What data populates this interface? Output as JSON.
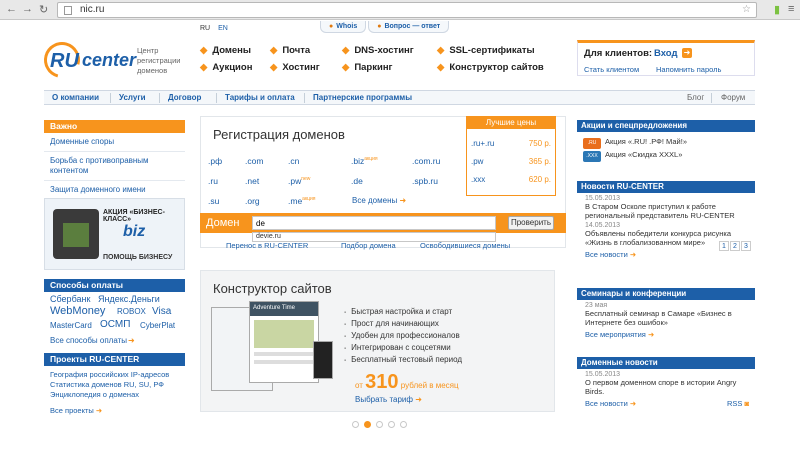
{
  "browser": {
    "url": "nic.ru"
  },
  "header": {
    "langs": [
      "RU",
      "EN"
    ],
    "top_tabs": [
      "Whois",
      "Вопрос — ответ"
    ],
    "logo_ru": "RU",
    "logo_center": "center",
    "logo_sub": "Центр регистрации доменов",
    "menu": [
      "Домены",
      "Почта",
      "DNS-хостинг",
      "SSL-сертификаты",
      "Аукцион",
      "Хостинг",
      "Паркинг",
      "Конструктор сайтов"
    ],
    "clients_title": "Для клиентов:",
    "login": "Вход",
    "become_client": "Стать клиентом",
    "remind_password": "Напомнить пароль"
  },
  "subnav": {
    "items": [
      "О компании",
      "Услуги",
      "Договор",
      "Тарифы и оплата",
      "Партнерские программы"
    ],
    "right": [
      "Блог",
      "Форум"
    ]
  },
  "left": {
    "important_title": "Важно",
    "important_items": [
      "Доменные споры",
      "Борьба с противоправным контентом",
      "Защита доменного имени"
    ],
    "promo_title": "АКЦИЯ «БИЗНЕС-КЛАСС»",
    "promo_biz": "biz",
    "promo_sub": "ПОМОЩЬ БИЗНЕСУ",
    "payments_title": "Способы оплаты",
    "payments": [
      "Сбербанк",
      "Яндекс.Деньги",
      "WebMoney",
      "ROBOX",
      "Visa",
      "MasterCard",
      "ОСМП",
      "CyberPlat"
    ],
    "all_payments": "Все способы оплаты",
    "projects_title": "Проекты RU-CENTER",
    "projects": [
      "География российских IP-адресов",
      "Статистика доменов RU, SU, РФ",
      "Энциклопедия о доменах"
    ],
    "all_projects": "Все проекты"
  },
  "domains": {
    "title": "Регистрация доменов",
    "zones": [
      ".рф",
      ".com",
      ".cn",
      ".biz",
      ".com.ru",
      ".ru",
      ".net",
      ".pw",
      ".de",
      ".spb.ru",
      ".su",
      ".org",
      ".me",
      ".xxx"
    ],
    "sup_biz": "акция",
    "sup_pw": "new",
    "sup_me": "акция",
    "all_domains": "Все домены",
    "best_title": "Лучшие цены",
    "best": [
      {
        "zone": ".ru+.ru",
        "price": "750 р."
      },
      {
        "zone": ".pw",
        "price": "365 р."
      },
      {
        "zone": ".xxx",
        "price": "620 р."
      }
    ],
    "search_label": "Домен",
    "search_value": "de",
    "check_button": "Проверить",
    "suggestion": "devie.ru",
    "links": [
      "Перенос в RU-CENTER",
      "Подбор домена",
      "Освободившиеся домены"
    ]
  },
  "builder": {
    "title": "Конструктор сайтов",
    "features": [
      "Быстрая настройка и старт",
      "Прост для начинающих",
      "Удобен для профессионалов",
      "Интегрирован с соцсетями",
      "Бесплатный тестовый период"
    ],
    "price_from": "от",
    "price_value": "310",
    "price_suffix": "рублей в месяц",
    "choose": "Выбрать тариф",
    "screen_text": "Adventure Time"
  },
  "right": {
    "promos_title": "Акции и спецпредложения",
    "promos": [
      "Акция «.RU! .РФ! Май!»",
      "Акция «Скидка XXXL»"
    ],
    "promo_badges": [
      ".RU",
      ".XXX"
    ],
    "news_title": "Новости RU-CENTER",
    "news": [
      {
        "date": "15.05.2013",
        "text": "В Старом Осколе приступил к работе региональный представитель RU-CENTER"
      },
      {
        "date": "14.05.2013",
        "text": "Объявлены победители конкурса рисунка «Жизнь в глобализованном мире»"
      }
    ],
    "all_news": "Все новости",
    "pages": [
      "1",
      "2",
      "3"
    ],
    "seminars_title": "Семинары и конференции",
    "seminar_date": "23 мая",
    "seminar_text": "Бесплатный семинар в Самаре «Бизнес в Интернете без ошибок»",
    "all_events": "Все мероприятия",
    "domain_news_title": "Доменные новости",
    "domain_news_date": "15.05.2013",
    "domain_news_text": "О первом доменном споре в истории Angry Birds.",
    "rss": "RSS"
  }
}
